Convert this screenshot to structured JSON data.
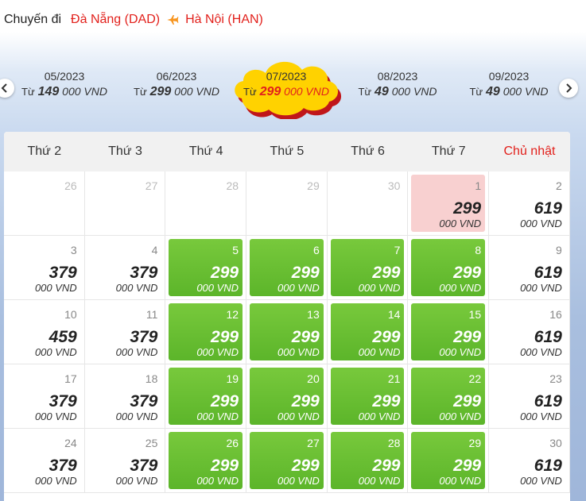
{
  "route": {
    "label": "Chuyến đi",
    "from": "Đà Nẵng (DAD)",
    "to": "Hà Nội (HAN)"
  },
  "months": [
    {
      "month": "05/2023",
      "prefix": "Từ",
      "price": "149",
      "suffix": "000 VND",
      "active": false
    },
    {
      "month": "06/2023",
      "prefix": "Từ",
      "price": "299",
      "suffix": "000 VND",
      "active": false
    },
    {
      "month": "07/2023",
      "prefix": "Từ",
      "price": "299",
      "suffix": "000 VND",
      "active": true
    },
    {
      "month": "08/2023",
      "prefix": "Từ",
      "price": "49",
      "suffix": "000 VND",
      "active": false
    },
    {
      "month": "09/2023",
      "prefix": "Từ",
      "price": "49",
      "suffix": "000 VND",
      "active": false
    }
  ],
  "weekdays": [
    "Thứ 2",
    "Thứ 3",
    "Thứ 4",
    "Thứ 5",
    "Thứ 6",
    "Thứ 7",
    "Chủ nhật"
  ],
  "currency": "000 VND",
  "colors": {
    "accent": "#e2211c",
    "green": "#6abf33",
    "highlight": "#f8d0d0",
    "cloud": "#ffd200"
  },
  "days": [
    {
      "day": "26",
      "price": "",
      "state": "empty"
    },
    {
      "day": "27",
      "price": "",
      "state": "empty"
    },
    {
      "day": "28",
      "price": "",
      "state": "empty"
    },
    {
      "day": "29",
      "price": "",
      "state": "empty"
    },
    {
      "day": "30",
      "price": "",
      "state": "empty"
    },
    {
      "day": "1",
      "price": "299",
      "state": "pink"
    },
    {
      "day": "2",
      "price": "619",
      "state": "normal"
    },
    {
      "day": "3",
      "price": "379",
      "state": "normal"
    },
    {
      "day": "4",
      "price": "379",
      "state": "normal"
    },
    {
      "day": "5",
      "price": "299",
      "state": "green"
    },
    {
      "day": "6",
      "price": "299",
      "state": "green"
    },
    {
      "day": "7",
      "price": "299",
      "state": "green"
    },
    {
      "day": "8",
      "price": "299",
      "state": "green"
    },
    {
      "day": "9",
      "price": "619",
      "state": "normal"
    },
    {
      "day": "10",
      "price": "459",
      "state": "normal"
    },
    {
      "day": "11",
      "price": "379",
      "state": "normal"
    },
    {
      "day": "12",
      "price": "299",
      "state": "green"
    },
    {
      "day": "13",
      "price": "299",
      "state": "green"
    },
    {
      "day": "14",
      "price": "299",
      "state": "green"
    },
    {
      "day": "15",
      "price": "299",
      "state": "green"
    },
    {
      "day": "16",
      "price": "619",
      "state": "normal"
    },
    {
      "day": "17",
      "price": "379",
      "state": "normal"
    },
    {
      "day": "18",
      "price": "379",
      "state": "normal"
    },
    {
      "day": "19",
      "price": "299",
      "state": "green"
    },
    {
      "day": "20",
      "price": "299",
      "state": "green"
    },
    {
      "day": "21",
      "price": "299",
      "state": "green"
    },
    {
      "day": "22",
      "price": "299",
      "state": "green"
    },
    {
      "day": "23",
      "price": "619",
      "state": "normal"
    },
    {
      "day": "24",
      "price": "379",
      "state": "normal"
    },
    {
      "day": "25",
      "price": "379",
      "state": "normal"
    },
    {
      "day": "26",
      "price": "299",
      "state": "green"
    },
    {
      "day": "27",
      "price": "299",
      "state": "green"
    },
    {
      "day": "28",
      "price": "299",
      "state": "green"
    },
    {
      "day": "29",
      "price": "299",
      "state": "green"
    },
    {
      "day": "30",
      "price": "619",
      "state": "normal"
    }
  ]
}
